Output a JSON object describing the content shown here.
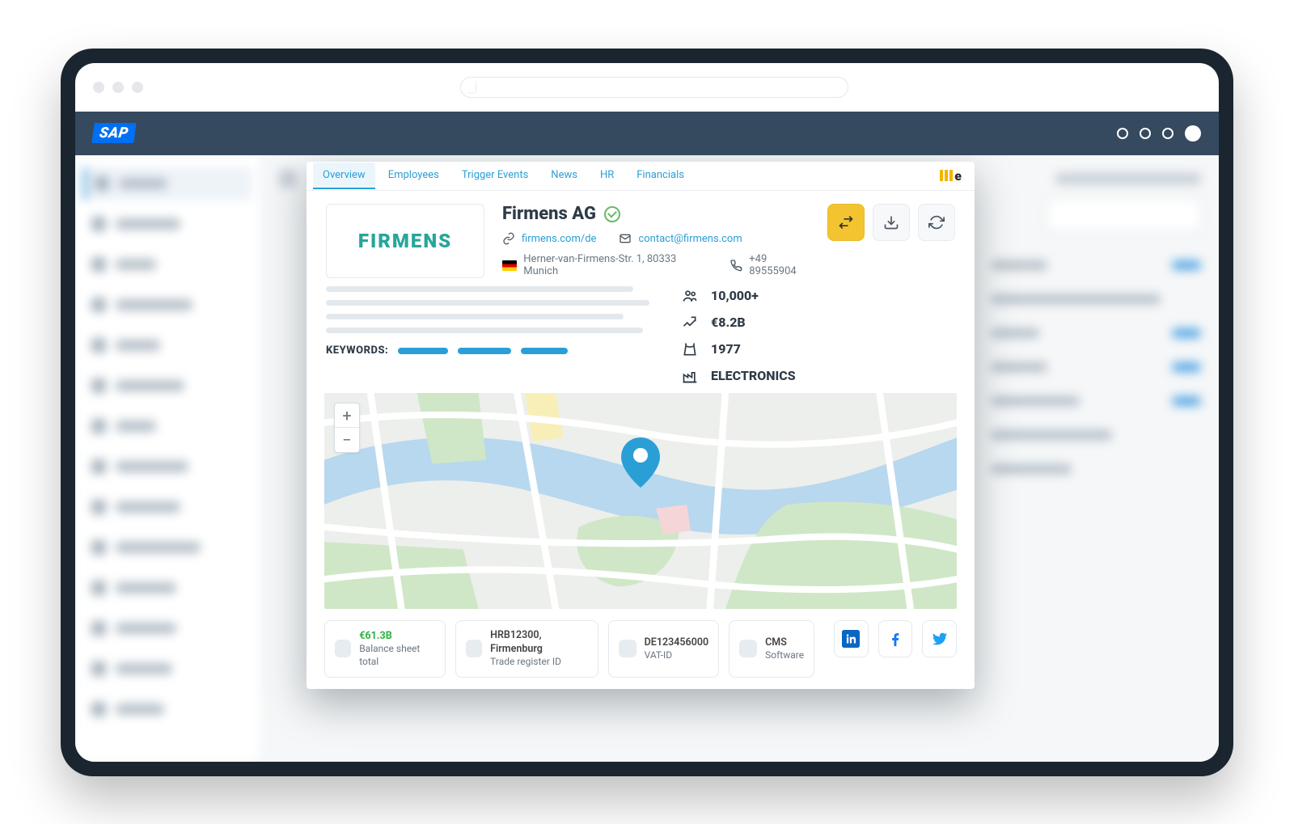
{
  "app_bar": {
    "logo": "SAP"
  },
  "tabs": {
    "items": [
      "Overview",
      "Employees",
      "Trigger Events",
      "News",
      "HR",
      "Financials"
    ],
    "active": "Overview"
  },
  "company": {
    "logo_text": "FIRMENS",
    "name": "Firmens AG",
    "website": "firmens.com/de",
    "email": "contact@firmens.com",
    "address": "Herner-van-Firmens-Str. 1, 80333 Munich",
    "phone": "+49 89555904"
  },
  "facts": {
    "employees": "10,000+",
    "revenue": "€8.2B",
    "founded": "1977",
    "industry": "ELECTRONICS"
  },
  "keywords_label": "KEYWORDS:",
  "footer": {
    "balance": {
      "value": "€61.3B",
      "label": "Balance sheet total"
    },
    "register": {
      "value": "HRB12300, Firmenburg",
      "label": "Trade register ID"
    },
    "vat": {
      "value": "DE123456000",
      "label": "VAT-ID"
    },
    "software": {
      "value": "CMS",
      "label": "Software"
    }
  },
  "map": {
    "zoom_in": "+",
    "zoom_out": "−"
  }
}
